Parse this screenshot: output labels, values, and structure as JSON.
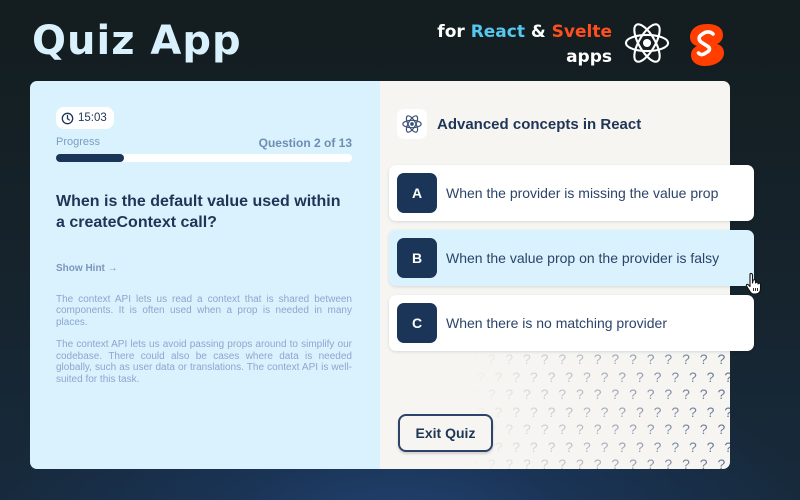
{
  "header": {
    "title": "Quiz App",
    "tagline_prefix": "for",
    "tagline_react": "React",
    "tagline_amp": "&",
    "tagline_svelte": "Svelte",
    "tagline_suffix": "apps",
    "colors": {
      "react": "#56c7ee",
      "svelte": "#ff4f1f"
    }
  },
  "quiz": {
    "timer": "15:03",
    "progress_label": "Progress",
    "question_counter": "Question 2 of 13",
    "progress_fraction": 0.23,
    "question": "When is the default value used within a createContext call?",
    "show_hint_label": "Show Hint →",
    "hint_paragraphs": [
      "The context API lets us read a context that is shared between components. It is often used when a prop is needed in many places.",
      "The context API lets us avoid passing props around to simplify our codebase. There could also be cases where data is needed globally, such as user data or translations. The context API is well-suited for this task."
    ],
    "topic_icon": "react-atom-icon",
    "topic_title": "Advanced concepts in React",
    "answers": [
      {
        "letter": "A",
        "text": "When the provider is missing the value prop",
        "selected": false
      },
      {
        "letter": "B",
        "text": "When the value prop on the provider is falsy",
        "selected": true
      },
      {
        "letter": "C",
        "text": "When there is no matching provider",
        "selected": false
      }
    ],
    "exit_label": "Exit Quiz"
  }
}
